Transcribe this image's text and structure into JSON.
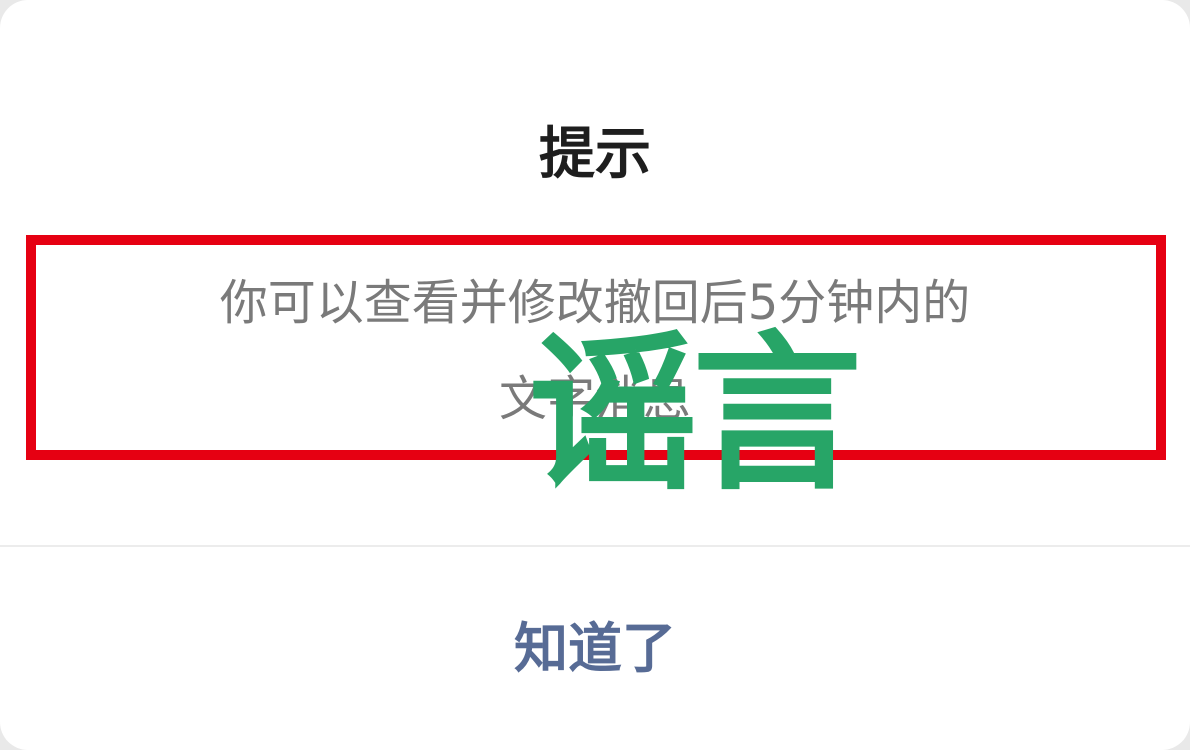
{
  "dialog": {
    "title": "提示",
    "message_line1": "你可以查看并修改撤回后5分钟内的",
    "message_line2": "文字消息",
    "confirm_label": "知道了"
  },
  "overlay": {
    "stamp_text": "谣言",
    "stamp_color": "#27a567",
    "highlight_color": "#e60012"
  },
  "colors": {
    "title": "#1e1e1e",
    "message": "#7a7a7a",
    "button_text": "#576b95",
    "background": "#ffffff"
  }
}
